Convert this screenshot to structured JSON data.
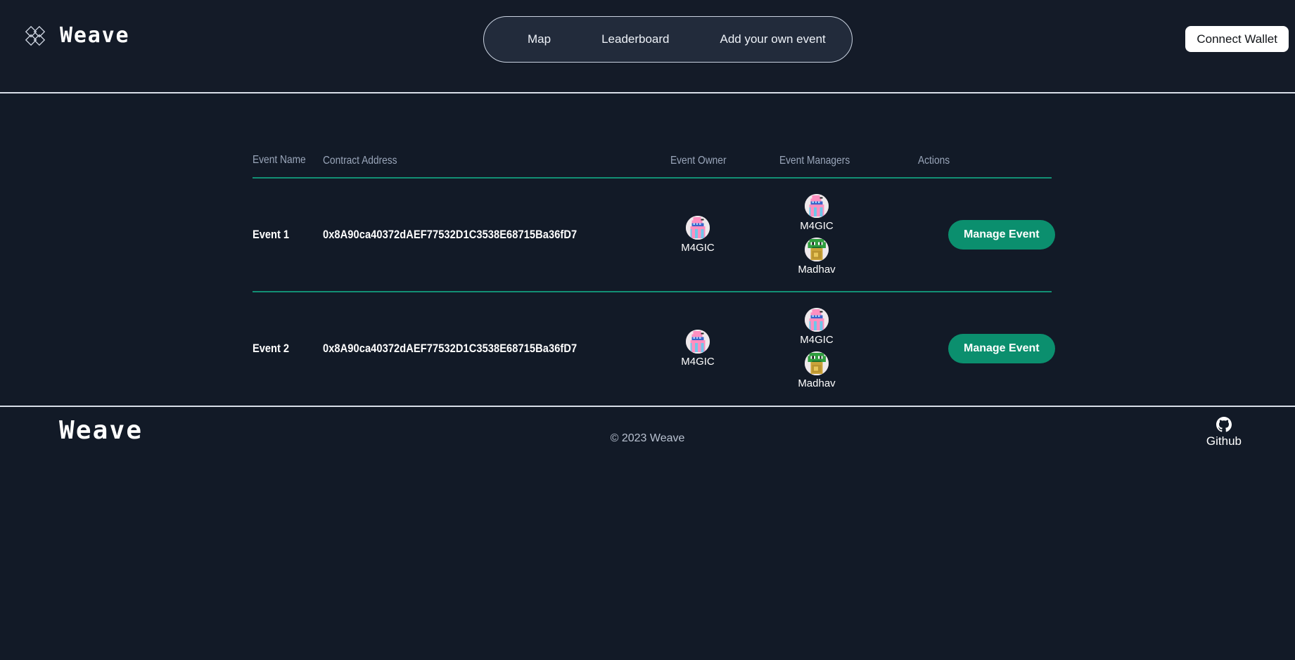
{
  "header": {
    "brand": "Weave",
    "brand_icon": "interlocking-squares-logo-icon",
    "nav": [
      {
        "id": "map",
        "label": "Map"
      },
      {
        "id": "leaderboard",
        "label": "Leaderboard"
      },
      {
        "id": "add-event",
        "label": "Add your own event"
      }
    ],
    "connect_wallet_label": "Connect Wallet"
  },
  "table": {
    "columns": [
      {
        "id": "event-name",
        "label": "Event Name"
      },
      {
        "id": "contract-address",
        "label": "Contract Address"
      },
      {
        "id": "event-owner",
        "label": "Event Owner"
      },
      {
        "id": "event-managers",
        "label": "Event Managers"
      },
      {
        "id": "actions",
        "label": "Actions"
      }
    ],
    "rows": [
      {
        "name": "Event 1",
        "contract_address": "0x8A90ca40372dAEF77532D1C3538E68715Ba36fD7",
        "owner": {
          "name": "M4GIC",
          "avatar": "pixel-flamingo-avatar"
        },
        "managers": [
          {
            "name": "M4GIC",
            "avatar": "pixel-flamingo-avatar"
          },
          {
            "name": "Madhav",
            "avatar": "pixel-frog-avatar"
          }
        ],
        "action_label": "Manage Event"
      },
      {
        "name": "Event 2",
        "contract_address": "0x8A90ca40372dAEF77532D1C3538E68715Ba36fD7",
        "owner": {
          "name": "M4GIC",
          "avatar": "pixel-flamingo-avatar"
        },
        "managers": [
          {
            "name": "M4GIC",
            "avatar": "pixel-flamingo-avatar"
          },
          {
            "name": "Madhav",
            "avatar": "pixel-frog-avatar"
          }
        ],
        "action_label": "Manage Event"
      }
    ]
  },
  "footer": {
    "brand": "Weave",
    "copyright": "© 2023 Weave",
    "github_label": "Github",
    "github_icon": "github-icon"
  },
  "colors": {
    "background": "#121a27",
    "header_background": "#141b28",
    "nav_pill_background": "#222b3b",
    "nav_pill_border": "#c9d2e0",
    "accent_teal": "#0b8f6e",
    "divider_teal": "#128f74",
    "muted_text": "#9aa6ba",
    "hairline": "#d8dee8"
  }
}
